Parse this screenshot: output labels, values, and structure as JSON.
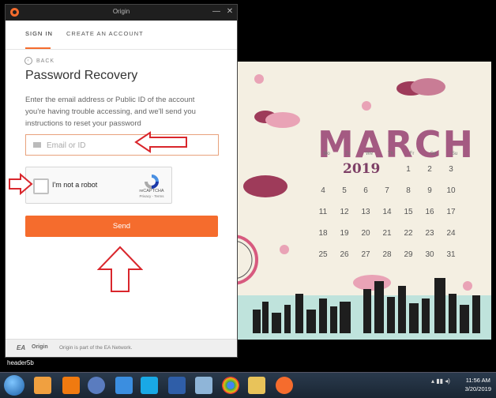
{
  "window": {
    "title": "Origin",
    "minimize_glyph": "—",
    "close_glyph": "✕"
  },
  "tabs": [
    {
      "label": "SIGN IN",
      "active": true
    },
    {
      "label": "CREATE AN ACCOUNT",
      "active": false
    }
  ],
  "back_label": "BACK",
  "heading": "Password Recovery",
  "description": "Enter the email address or Public ID of the account you're having trouble accessing, and we'll send you instructions to reset your password",
  "email_field": {
    "placeholder": "Email or ID",
    "value": ""
  },
  "captcha": {
    "label": "I'm not a robot",
    "brand": "reCAPTCHA",
    "links": "Privacy - Terms",
    "checked": false
  },
  "send_label": "Send",
  "footer": {
    "ea": "EA",
    "origin_mini": "Origin",
    "text": "Origin is part of the EA Network."
  },
  "below_window_label": "header5b",
  "wallpaper": {
    "month": "MARCH",
    "year": "2019",
    "weekdays": [
      "Mo",
      "Tu",
      "We",
      "Th",
      "Fr",
      "Sa",
      "Su"
    ]
  },
  "taskbar": {
    "time": "11:56 AM",
    "date": "3/20/2019",
    "icons": [
      "start-orb-icon",
      "media-player-icon",
      "vlc-icon",
      "chrome-canary-icon",
      "internet-explorer-icon",
      "skype-icon",
      "word-icon",
      "paint-icon",
      "chrome-icon",
      "file-explorer-icon",
      "origin-icon"
    ]
  },
  "colors": {
    "accent": "#f56c2d",
    "annotation": "#d9262c"
  }
}
